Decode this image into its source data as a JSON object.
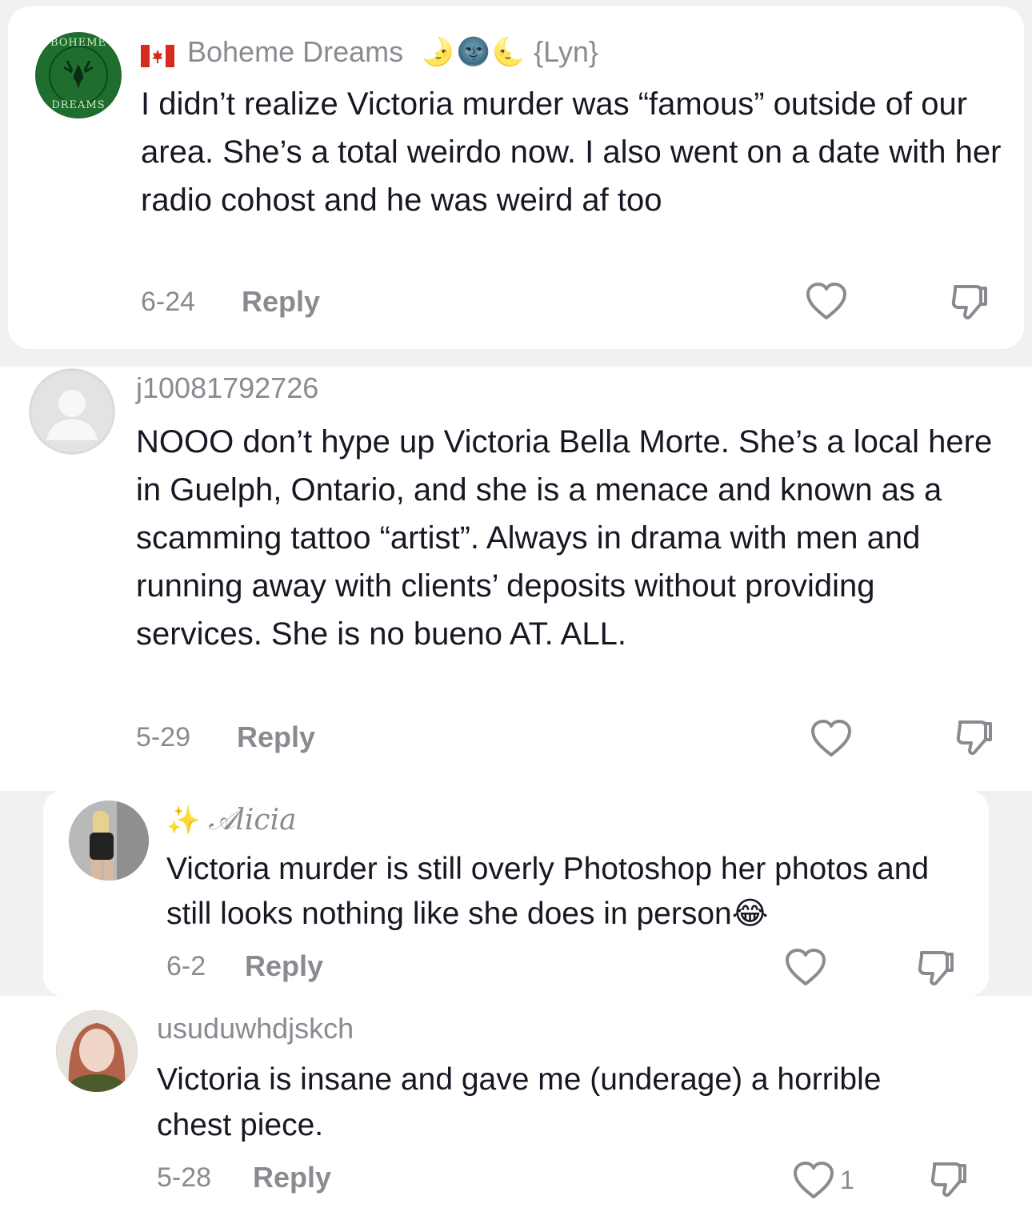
{
  "comments": [
    {
      "username": "Boheme Dreams",
      "name_suffix": "{Lyn}",
      "flag": "🇨🇦",
      "emojis": [
        "🌛",
        "🌚",
        "🌜"
      ],
      "text": "I didn’t realize Victoria murder was “famous” outside of our area. She’s a total weirdo now. I also went on a date with her radio cohost and he was weird af too",
      "date": "6-24",
      "reply_label": "Reply",
      "avatar_text_top": "BOHEME",
      "avatar_text_bottom": "DREAMS"
    },
    {
      "username": "j10081792726",
      "text": "NOOO don’t hype up Victoria Bella Morte. She’s a local here in Guelph, Ontario, and she is a menace and known as a scamming tattoo “artist”. Always in drama with men and running away with clients’ deposits without providing services. She is no bueno AT. ALL.",
      "date": "5-29",
      "reply_label": "Reply"
    },
    {
      "username": "𝒜licia",
      "prefix_emoji": "✨",
      "text": "Victoria murder is still overly Photoshop her photos and still looks nothing like she does in person😂",
      "date": "6-2",
      "reply_label": "Reply"
    },
    {
      "username": "usuduwhdjskch",
      "text": "Victoria is insane and gave me (underage) a horrible chest piece.",
      "date": "5-28",
      "reply_label": "Reply",
      "like_count": "1"
    }
  ]
}
